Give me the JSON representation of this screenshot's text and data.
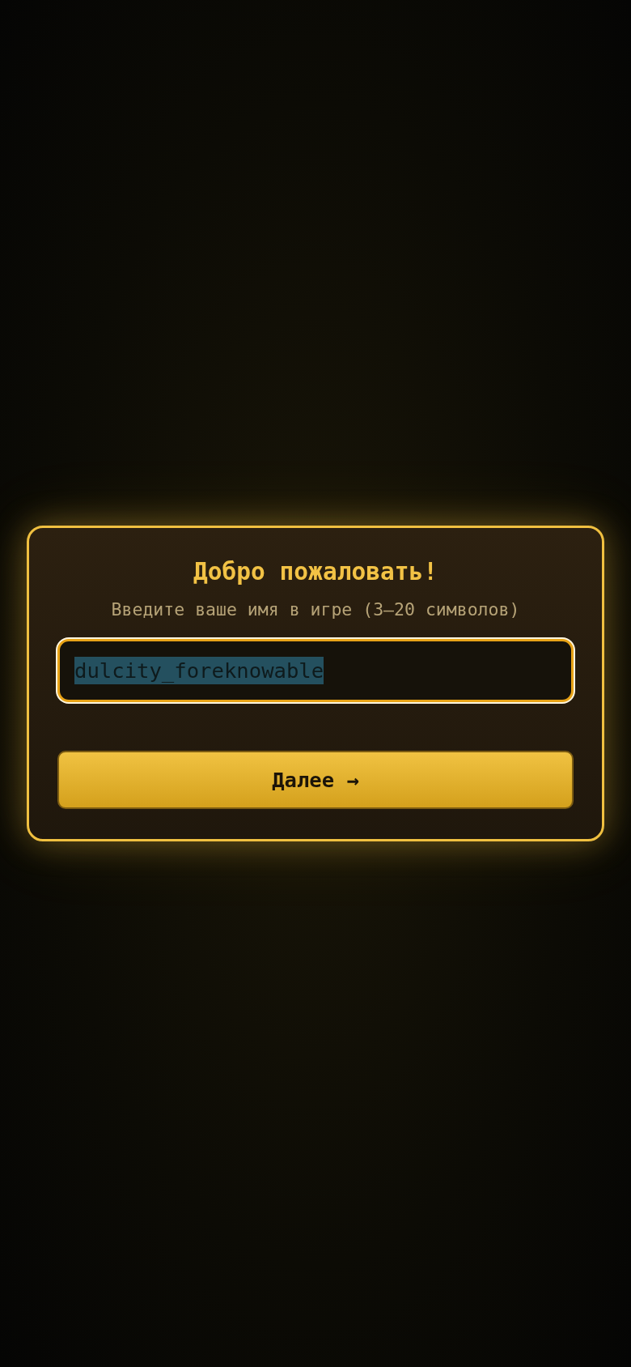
{
  "dialog": {
    "title": "Добро пожаловать!",
    "subtitle": "Введите ваше имя в игре (3—20 символов)",
    "name_field": {
      "value": "dulcity_foreknowable",
      "focused": true,
      "text_selected": true
    },
    "button": {
      "label": "Далее →"
    }
  }
}
